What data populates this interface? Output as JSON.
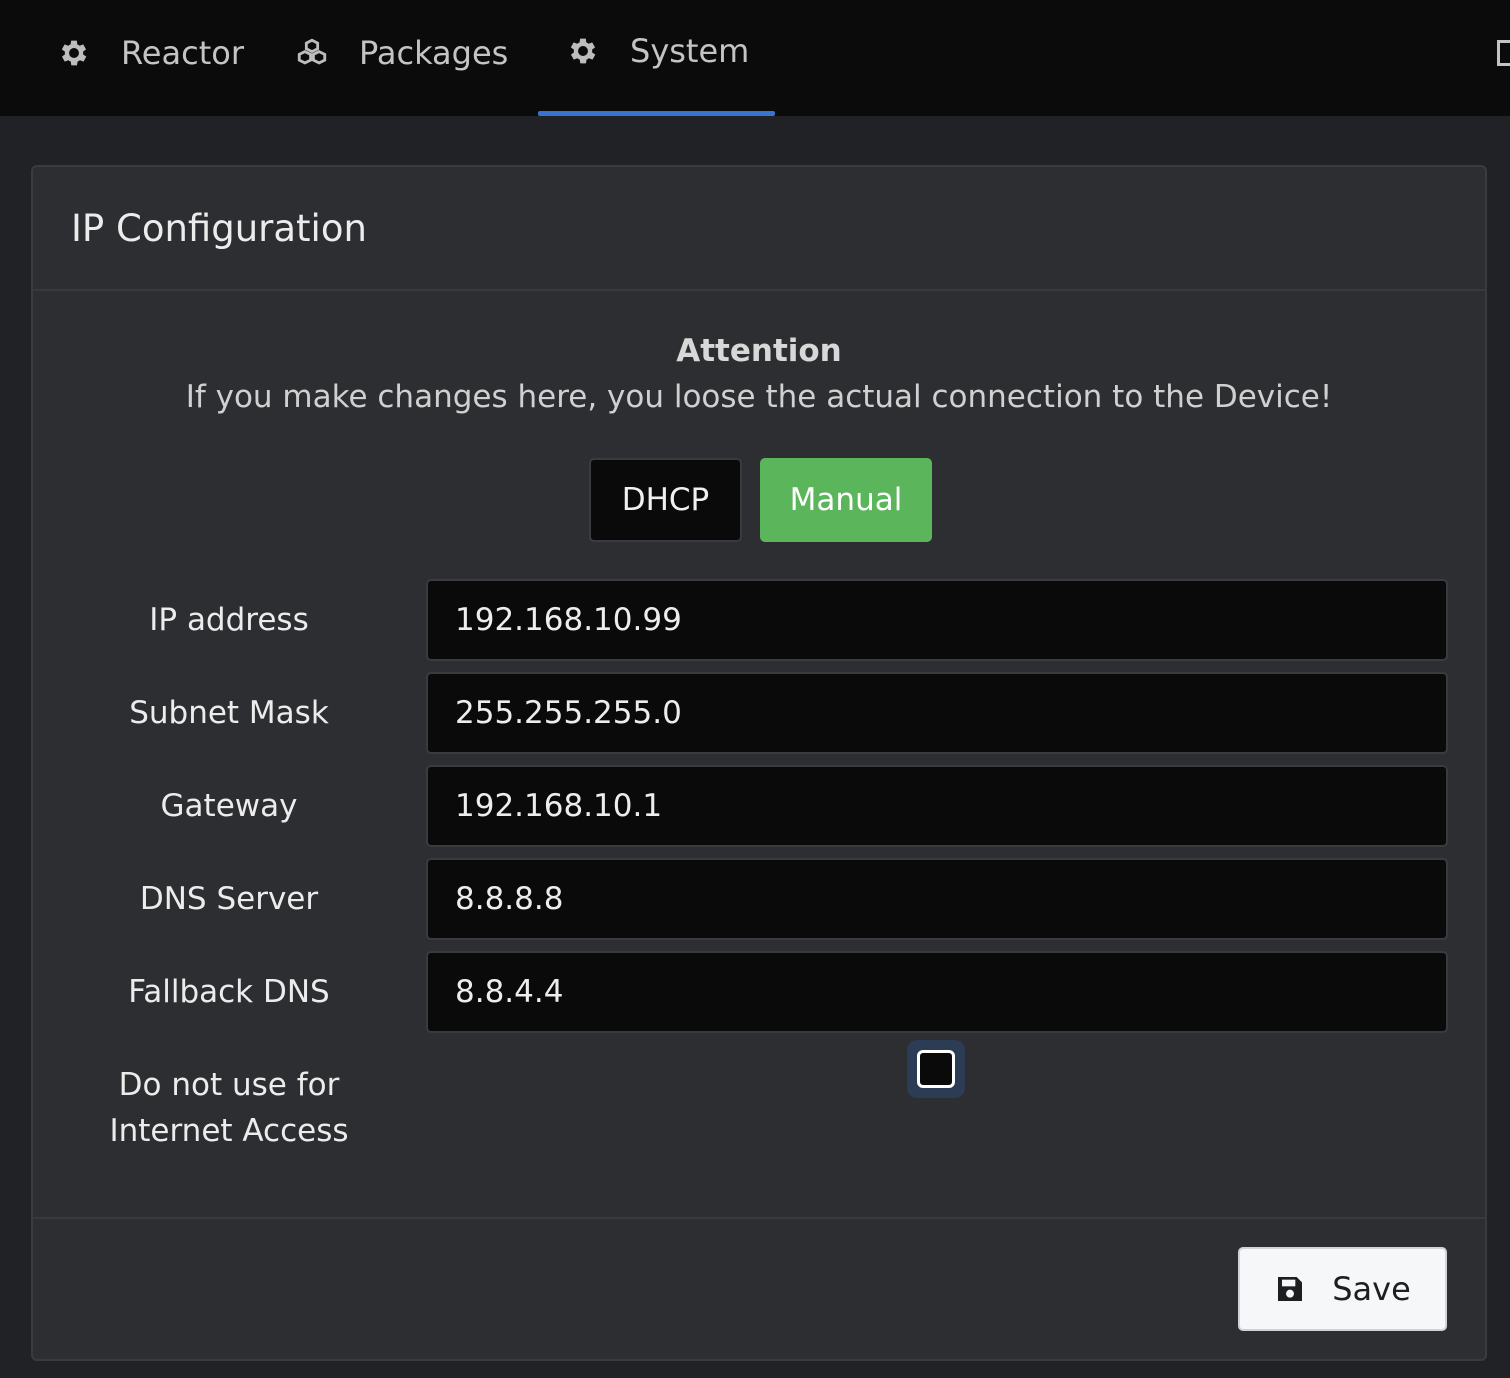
{
  "nav": {
    "items": [
      {
        "label": "Reactor",
        "icon": "gear-icon"
      },
      {
        "label": "Packages",
        "icon": "cubes-icon"
      },
      {
        "label": "System",
        "icon": "gear-icon",
        "active": true
      }
    ],
    "active_color": "#3973d0"
  },
  "card": {
    "title": "IP Configuration",
    "attention_title": "Attention",
    "attention_text": "If you make changes here, you loose the actual connection to the Device!",
    "mode_buttons": {
      "dhcp_label": "DHCP",
      "manual_label": "Manual",
      "selected": "Manual",
      "selected_color": "#5bb55b"
    },
    "fields": [
      {
        "label": "IP address",
        "value": "192.168.10.99"
      },
      {
        "label": "Subnet Mask",
        "value": "255.255.255.0"
      },
      {
        "label": "Gateway",
        "value": "192.168.10.1"
      },
      {
        "label": "DNS Server",
        "value": "8.8.8.8"
      },
      {
        "label": "Fallback DNS",
        "value": "8.8.4.4"
      }
    ],
    "no_internet": {
      "label": "Do not use for Internet Access",
      "checked": false
    },
    "save_label": "Save",
    "save_icon": "floppy-disk-icon"
  }
}
